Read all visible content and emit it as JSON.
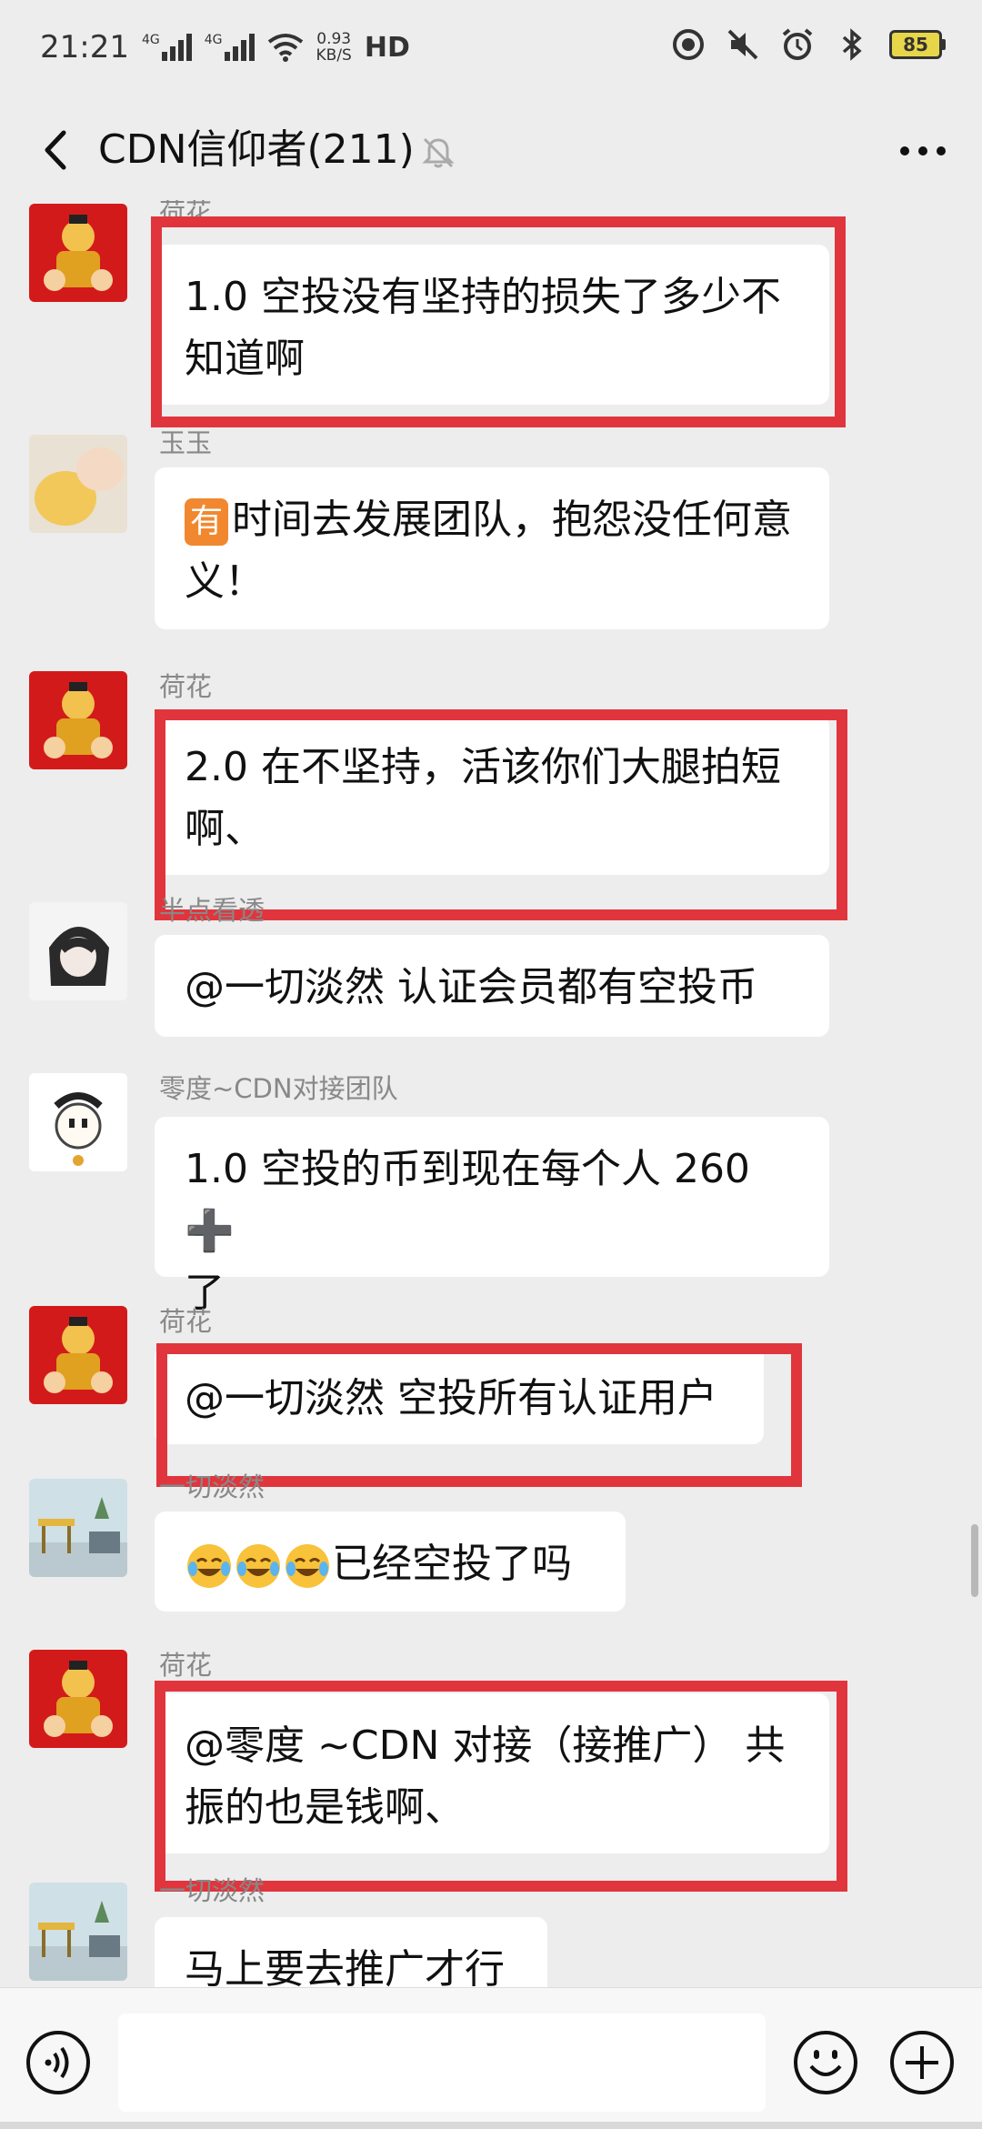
{
  "status_bar": {
    "time": "21:21",
    "network_1": "4G",
    "network_2": "4G",
    "speed_value": "0.93",
    "speed_unit": "KB/S",
    "hd": "HD",
    "battery": "85"
  },
  "header": {
    "title": "CDN信仰者(211)"
  },
  "messages": [
    {
      "sender": "荷花",
      "text": "1.0 空投没有坚持的损失了多少不知道啊"
    },
    {
      "sender": "玉玉",
      "badge": "有",
      "text": "时间去发展团队，抱怨没任何意义！"
    },
    {
      "sender": "荷花",
      "text": "2.0 在不坚持，活该你们大腿拍短啊、"
    },
    {
      "sender": "半点看透",
      "text": "@一切淡然  认证会员都有空投币"
    },
    {
      "sender": "零度~CDN对接团队",
      "text": "1.0 空投的币到现在每个人 260",
      "plus": "➕",
      "text_tail": "了"
    },
    {
      "sender": "荷花",
      "text": "@一切淡然 空投所有认证用户"
    },
    {
      "sender": "一切淡然",
      "text": "已经空投了吗"
    },
    {
      "sender": "荷花",
      "text": "@零度 ~CDN 对接（接推广） 共振的也是钱啊、"
    },
    {
      "sender": "一切淡然",
      "text": "马上要去推广才行"
    }
  ],
  "colors": {
    "highlight": "#e1353d",
    "background": "#ededed",
    "bubble": "#ffffff"
  },
  "icons": [
    "back-icon",
    "mute-icon",
    "more-icon",
    "voice-icon",
    "emoji-icon",
    "plus-icon",
    "laughing-emoji"
  ]
}
